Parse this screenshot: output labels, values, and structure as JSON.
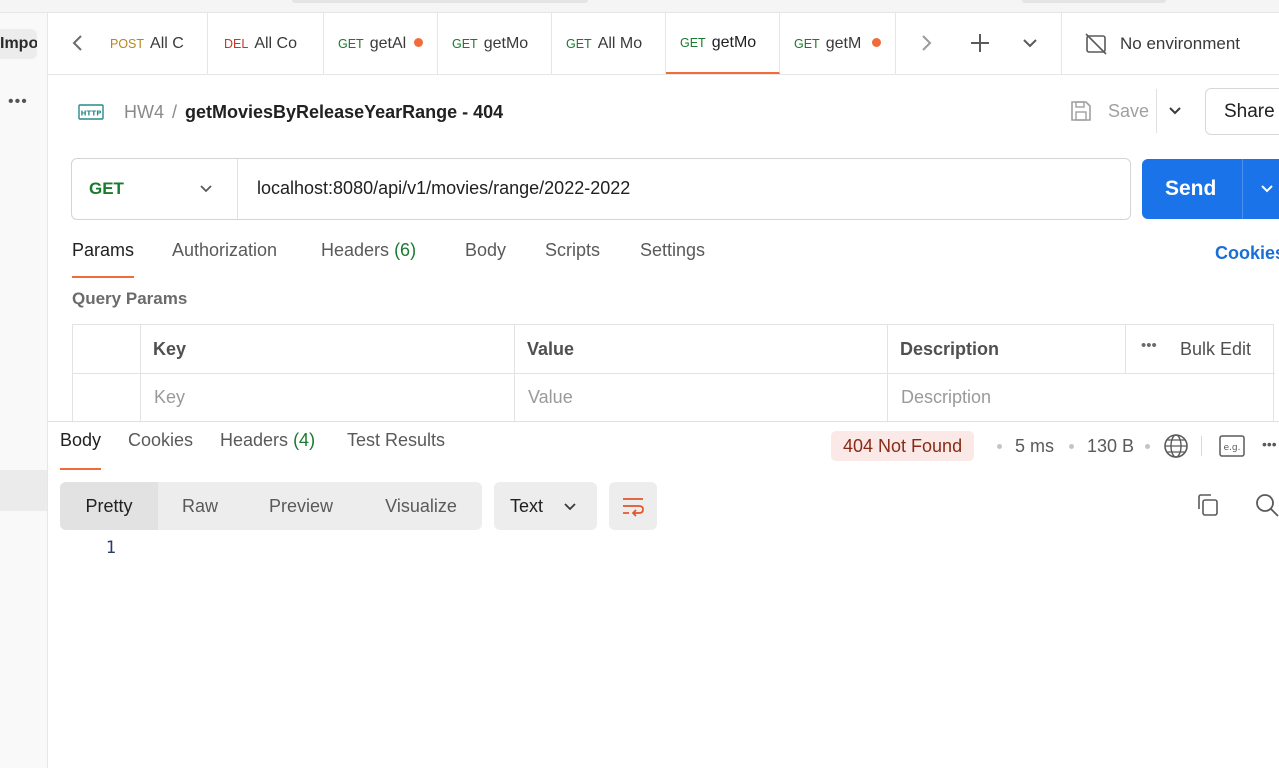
{
  "sidebar": {
    "import_label": "Import",
    "more_icon": "more-horizontal-icon"
  },
  "tabs": [
    {
      "method": "POST",
      "method_color": "#b8861a",
      "name": "All C",
      "unsaved": false,
      "active": false
    },
    {
      "method": "DEL",
      "method_color": "#c0392b",
      "name": "All Co",
      "unsaved": false,
      "active": false
    },
    {
      "method": "GET",
      "method_color": "#1a7a2e",
      "name": "getAl",
      "unsaved": true,
      "active": false
    },
    {
      "method": "GET",
      "method_color": "#1a7a2e",
      "name": "getMo",
      "unsaved": false,
      "active": false
    },
    {
      "method": "GET",
      "method_color": "#1a7a2e",
      "name": "All Mo",
      "unsaved": false,
      "active": false
    },
    {
      "method": "GET",
      "method_color": "#1a7a2e",
      "name": "getMo",
      "unsaved": false,
      "active": true
    },
    {
      "method": "GET",
      "method_color": "#1a7a2e",
      "name": "getM",
      "unsaved": true,
      "active": false
    }
  ],
  "environment": {
    "label": "No environment"
  },
  "breadcrumb": {
    "collection": "HW4",
    "separator": "/",
    "request_name": "getMoviesByReleaseYearRange - 404"
  },
  "actions": {
    "save_label": "Save",
    "share_label": "Share"
  },
  "request": {
    "method": "GET",
    "url": "localhost:8080/api/v1/movies/range/2022-2022",
    "send_label": "Send"
  },
  "request_tabs": {
    "params": "Params",
    "authorization": "Authorization",
    "headers": "Headers",
    "headers_count": "(6)",
    "body": "Body",
    "scripts": "Scripts",
    "settings": "Settings",
    "cookies": "Cookies"
  },
  "query_params": {
    "title": "Query Params",
    "columns": {
      "key": "Key",
      "value": "Value",
      "description": "Description",
      "bulk_edit": "Bulk Edit"
    },
    "placeholders": {
      "key": "Key",
      "value": "Value",
      "description": "Description"
    }
  },
  "response_tabs": {
    "body": "Body",
    "cookies": "Cookies",
    "headers": "Headers",
    "headers_count": "(4)",
    "test_results": "Test Results"
  },
  "response_meta": {
    "status": "404 Not Found",
    "time": "5 ms",
    "size": "130 B"
  },
  "view": {
    "pretty": "Pretty",
    "raw": "Raw",
    "preview": "Preview",
    "visualize": "Visualize",
    "format": "Text"
  },
  "editor": {
    "line_numbers": [
      "1"
    ]
  },
  "colors": {
    "accent": "#f26b3a",
    "send": "#1a73e8",
    "get": "#1a7a2e",
    "status_bg": "#fbe9e7"
  }
}
